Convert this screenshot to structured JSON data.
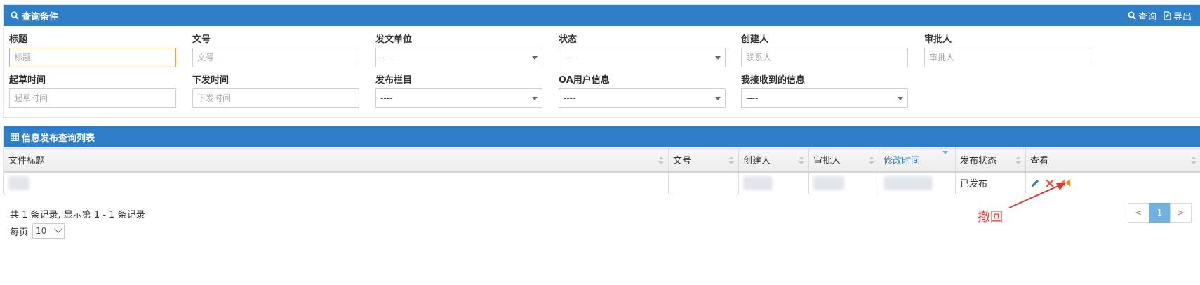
{
  "search_panel": {
    "title": "查询条件",
    "query_label": "查询",
    "export_label": "导出",
    "fields": [
      {
        "label": "标题",
        "placeholder": "标题"
      },
      {
        "label": "文号",
        "placeholder": "文号"
      },
      {
        "label": "发文单位",
        "value": "----"
      },
      {
        "label": "状态",
        "value": "----"
      },
      {
        "label": "创建人",
        "placeholder": "联系人"
      },
      {
        "label": "审批人",
        "placeholder": "审批人"
      },
      {
        "label": "起草时间",
        "placeholder": "起草时间"
      },
      {
        "label": "下发时间",
        "placeholder": "下发时间"
      },
      {
        "label": "发布栏目",
        "value": "----"
      },
      {
        "label": "OA用户信息",
        "value": "----"
      },
      {
        "label": "我接收到的信息",
        "value": "----"
      }
    ]
  },
  "list_panel": {
    "title": "信息发布查询列表",
    "columns": [
      "文件标题",
      "文号",
      "创建人",
      "审批人",
      "修改时间",
      "发布状态",
      "查看"
    ],
    "rows": [
      {
        "status": "已发布"
      }
    ]
  },
  "pagination": {
    "summary": "共 1 条记录, 显示第 1 - 1 条记录",
    "per_page_label": "每页",
    "per_page_value": "10",
    "prev": "<",
    "current": "1",
    "next": ">"
  },
  "annotation": {
    "text": "撤回"
  },
  "colors": {
    "header_blue": "#2f7fc8",
    "focus_orange": "#f0a04b",
    "annotation_red": "#e8312a",
    "edit_blue": "#2f7fc8",
    "delete_red": "#e05a4f",
    "revoke_orange": "#f08a2b",
    "page_active": "#6fb3e0"
  }
}
